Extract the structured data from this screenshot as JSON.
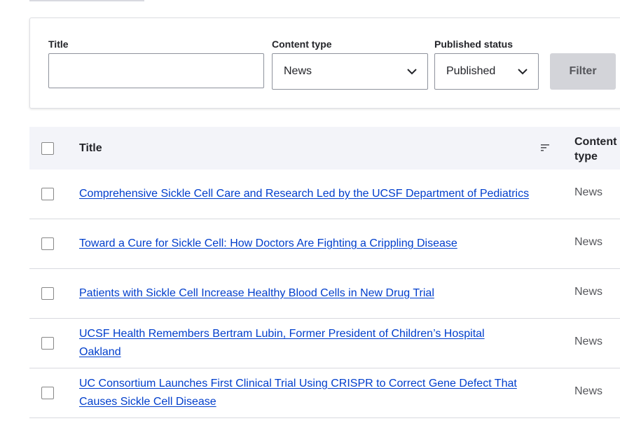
{
  "filters": {
    "title_label": "Title",
    "title_value": "",
    "content_type_label": "Content type",
    "content_type_value": "News",
    "published_status_label": "Published status",
    "published_status_value": "Published",
    "filter_button": "Filter"
  },
  "table": {
    "header": {
      "title": "Title",
      "content_type": "Content\ntype"
    },
    "rows": [
      {
        "title": "Comprehensive Sickle Cell Care and Research Led by the UCSF Department of Pediatrics",
        "type": "News"
      },
      {
        "title": "Toward a Cure for Sickle Cell: How Doctors Are Fighting a Crippling Disease",
        "type": "News"
      },
      {
        "title": "Patients with Sickle Cell Increase Healthy Blood Cells in New Drug Trial",
        "type": "News"
      },
      {
        "title": "UCSF Health Remembers Bertram Lubin, Former President of Children’s Hospital Oakland",
        "type": "News"
      },
      {
        "title": "UC Consortium Launches First Clinical Trial Using CRISPR to Correct Gene Defect That Causes Sickle Cell Disease",
        "type": "News"
      }
    ]
  },
  "icons": {
    "select_chevron": "chevron-down-icon",
    "sort": "sort-icon"
  },
  "colors": {
    "link": "#003ecc",
    "header_bg": "#f3f4f9",
    "button_bg": "#d3d4d9"
  }
}
